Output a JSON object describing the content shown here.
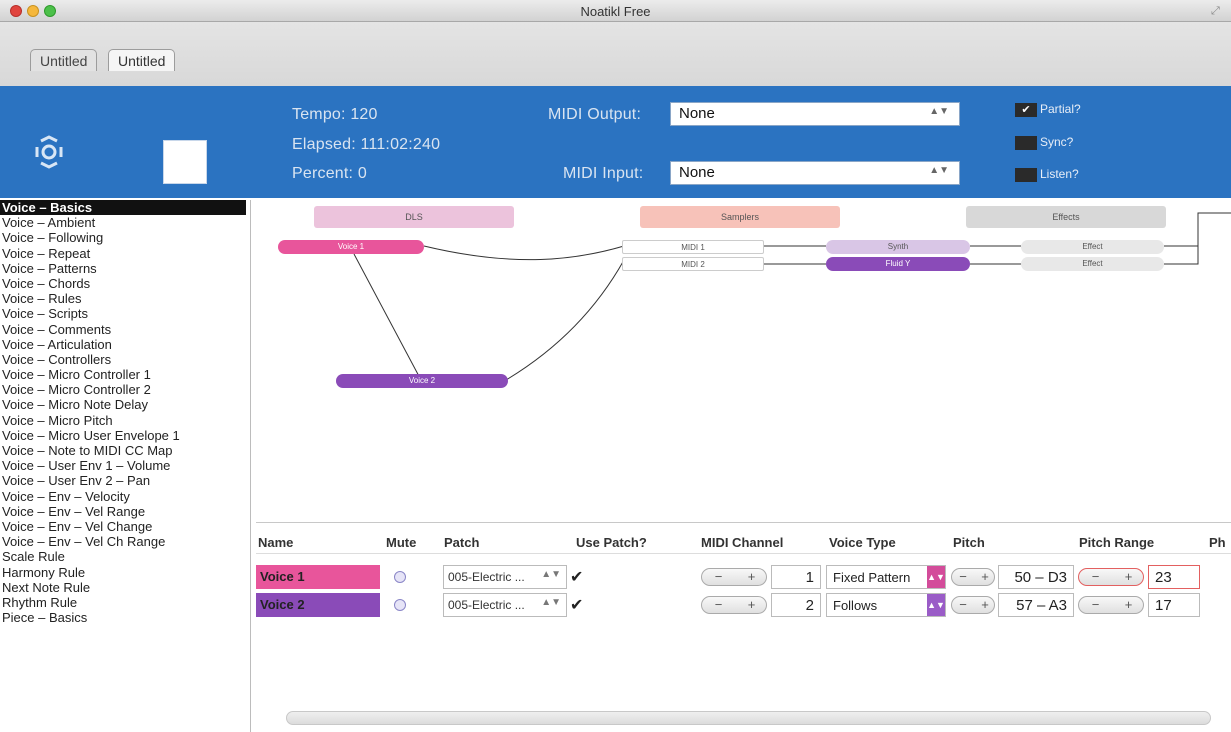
{
  "window": {
    "title": "Noatikl Free"
  },
  "tabs": [
    "Untitled",
    "Untitled"
  ],
  "header": {
    "tempo": "Tempo: 120",
    "elapsed": "Elapsed: 111:02:240",
    "percent": "Percent: 0",
    "midi_output_label": "MIDI Output:",
    "midi_output_value": "None",
    "midi_input_label": "MIDI Input:",
    "midi_input_value": "None",
    "partial": "Partial?",
    "sync": "Sync?",
    "listen": "Listen?"
  },
  "sidebar": {
    "items": [
      "Voice – Basics",
      "Voice – Ambient",
      "Voice – Following",
      "Voice – Repeat",
      "Voice – Patterns",
      "Voice – Chords",
      "Voice – Rules",
      "Voice – Scripts",
      "Voice – Comments",
      "Voice – Articulation",
      "Voice – Controllers",
      "Voice – Micro Controller 1",
      "Voice – Micro Controller 2",
      "Voice – Micro Note Delay",
      "Voice – Micro Pitch",
      "Voice – Micro User Envelope 1",
      "Voice – Note to MIDI CC Map",
      "Voice – User Env 1 – Volume",
      "Voice – User Env 2 – Pan",
      "Voice – Env – Velocity",
      "Voice – Env – Vel Range",
      "Voice – Env – Vel Change",
      "Voice – Env – Vel Ch Range",
      "Scale Rule",
      "Harmony Rule",
      "Next Note Rule",
      "Rhythm Rule",
      "Piece – Basics"
    ]
  },
  "graph": {
    "columns": {
      "left": "DLS",
      "middle": "Samplers",
      "right": "Effects"
    },
    "nodes": {
      "voice1": "Voice 1",
      "voice2": "Voice 2",
      "midi1": "MIDI 1",
      "midi2": "MIDI 2",
      "synth": "Synth",
      "fluid": "Fluid Y",
      "effect1": "Effect",
      "effect2": "Effect"
    }
  },
  "table": {
    "headers": [
      "Name",
      "Mute",
      "Patch",
      "Use Patch?",
      "MIDI Channel",
      "Voice Type",
      "Pitch",
      "Pitch Range",
      "Ph"
    ],
    "rows": [
      {
        "name": "Voice 1",
        "patch": "005-Electric ...",
        "use_patch": "✔",
        "channel": "1",
        "voice_type": "Fixed Pattern",
        "pitch": "50 – D3",
        "pitch_range": "23",
        "color": "#e8559b"
      },
      {
        "name": "Voice 2",
        "patch": "005-Electric ...",
        "use_patch": "✔",
        "channel": "2",
        "voice_type": "Follows",
        "pitch": "57 – A3",
        "pitch_range": "17",
        "color": "#8a4bb8"
      }
    ]
  },
  "colors": {
    "header_blue": "#2b73c1",
    "voice1": "#e8559b",
    "voice2": "#8a4bb8"
  }
}
